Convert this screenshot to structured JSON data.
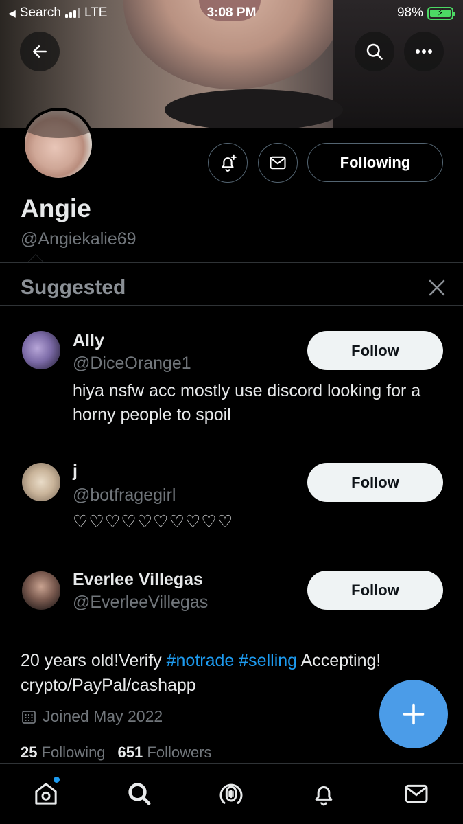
{
  "status_bar": {
    "back_app": "Search",
    "network": "LTE",
    "time": "3:08 PM",
    "battery": "98%"
  },
  "profile": {
    "name": "Angie",
    "handle": "@Angiekalie69",
    "following_button": "Following",
    "bio_prefix": "20 years old!Verify ",
    "bio_tag1": "#notrade",
    "bio_space": " ",
    "bio_tag2": "#selling",
    "bio_suffix": " Accepting! crypto/PayPal/cashapp",
    "joined": "Joined May 2022",
    "following_count": "25",
    "following_label": "Following",
    "followers_count": "651",
    "followers_label": "Followers"
  },
  "suggested": {
    "title": "Suggested",
    "users": [
      {
        "name": "Ally",
        "handle": "@DiceOrange1",
        "bio": "hiya nsfw acc mostly use discord looking for a horny people to spoil",
        "button": "Follow"
      },
      {
        "name": "j",
        "handle": "@botfragegirl",
        "bio": "♡♡♡♡♡♡♡♡♡♡",
        "button": "Follow"
      },
      {
        "name": "Everlee Villegas",
        "handle": "@EverleeVillegas",
        "bio": "",
        "button": "Follow"
      }
    ]
  },
  "icons": [
    "back-arrow-icon",
    "search-icon",
    "more-icon",
    "bell-plus-icon",
    "mail-icon",
    "close-icon",
    "calendar-icon",
    "plus-icon",
    "home-icon",
    "spaces-icon",
    "notifications-icon"
  ],
  "colors": {
    "accent": "#1d9bf0",
    "fab": "#4b9ce8",
    "battery": "#4cd964"
  }
}
